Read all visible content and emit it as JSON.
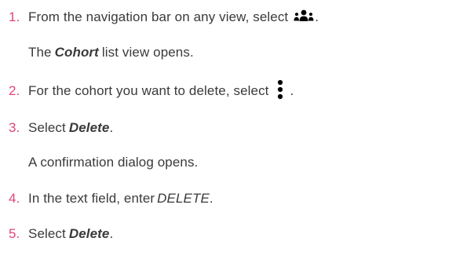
{
  "steps": [
    {
      "number": "1.",
      "pre": "From the navigation bar on any view, select",
      "icon": "people-group-icon",
      "post": ".",
      "result": {
        "pre": "The",
        "emphasis": "Cohort",
        "post": "list view opens."
      }
    },
    {
      "number": "2.",
      "pre": "For the cohort you want to delete, select",
      "icon": "vertical-ellipsis-icon",
      "post": "."
    },
    {
      "number": "3.",
      "pre": "Select",
      "emphasis": "Delete",
      "post": ".",
      "result": {
        "text": "A confirmation dialog opens."
      }
    },
    {
      "number": "4.",
      "pre": "In the text field, enter",
      "emphasis": "DELETE",
      "post": "."
    },
    {
      "number": "5.",
      "pre": "Select",
      "emphasis": "Delete",
      "post": "."
    }
  ],
  "colors": {
    "step_number": "#e0457b",
    "body_text": "#3a3a3a"
  }
}
